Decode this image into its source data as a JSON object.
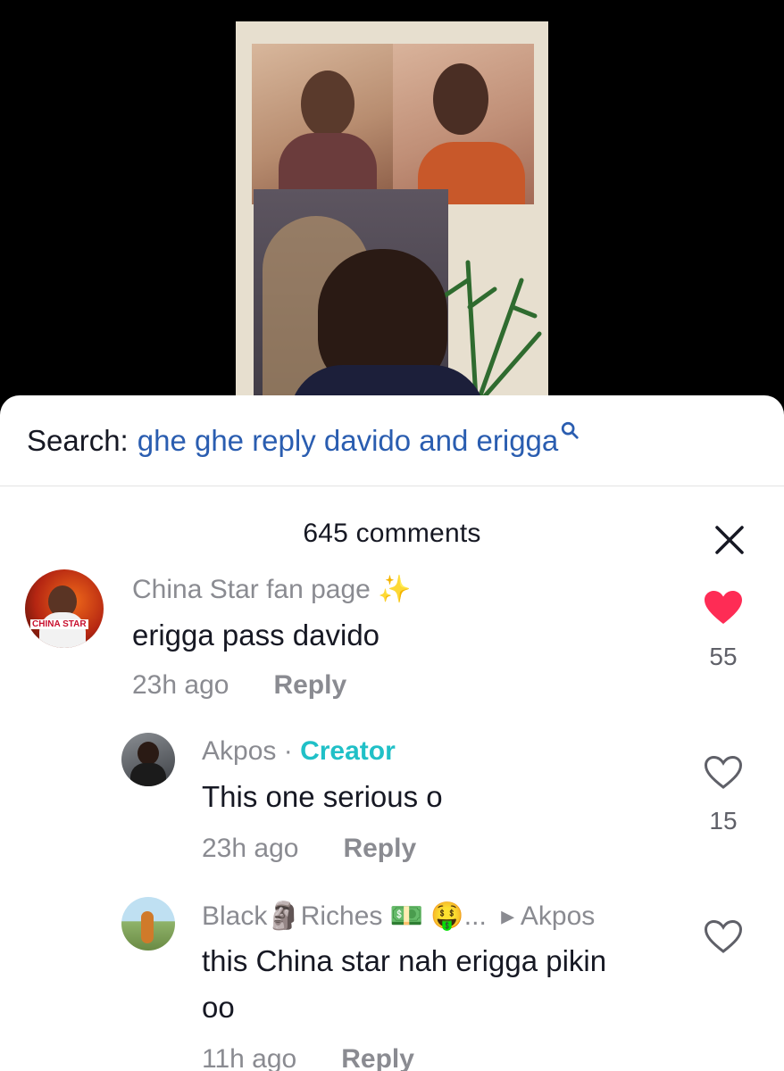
{
  "search": {
    "label": "Search:",
    "query": "ghe ghe reply davido and erigga"
  },
  "comments_header": "645 comments",
  "comments": [
    {
      "username": "China Star fan page ✨",
      "text": "erigga pass davido",
      "time": "23h ago",
      "reply_label": "Reply",
      "likes": "55",
      "liked": true,
      "avatar_text": "CHINA STAR"
    },
    {
      "username": "Akpos",
      "separator": " · ",
      "badge": "Creator",
      "text": "This one serious o",
      "time": "23h ago",
      "reply_label": "Reply",
      "likes": "15",
      "liked": false
    },
    {
      "username": "Black🗿Riches 💵 🤑...",
      "reply_to": "▸ Akpos",
      "text": "this China star nah erigga pikin oo",
      "time": "11h ago",
      "reply_label": "Reply",
      "likes": "",
      "liked": false
    }
  ],
  "colors": {
    "accent_link": "#2a5db0",
    "creator_badge": "#20c0c7",
    "like_red": "#fe2c55",
    "muted": "#8a8b91"
  },
  "icons": [
    "search-icon",
    "close-icon",
    "heart-filled-icon",
    "heart-outline-icon"
  ]
}
